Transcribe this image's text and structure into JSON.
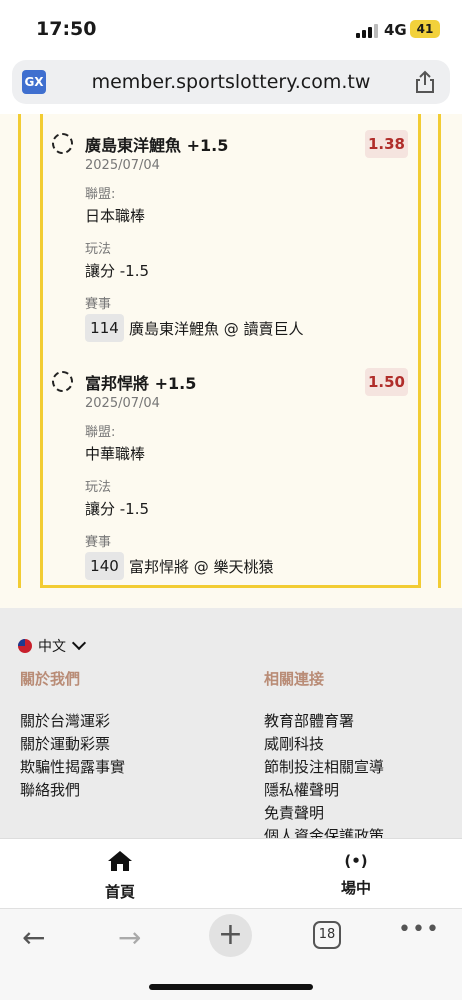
{
  "status": {
    "time": "17:50",
    "network": "4G",
    "battery": "41"
  },
  "browser": {
    "url": "member.sportslottery.com.tw",
    "translate_label": "GX",
    "tab_count": "18"
  },
  "bets": [
    {
      "team": "廣島東洋鯉魚 +1.5",
      "date": "2025/07/04",
      "odds": "1.38",
      "league_label": "聯盟:",
      "league": "日本職棒",
      "play_label": "玩法",
      "play": "讓分 -1.5",
      "event_label": "賽事",
      "event_num": "114",
      "event": "廣島東洋鯉魚 @ 讀賣巨人"
    },
    {
      "team": "富邦悍將 +1.5",
      "date": "2025/07/04",
      "odds": "1.50",
      "league_label": "聯盟:",
      "league": "中華職棒",
      "play_label": "玩法",
      "play": "讓分 -1.5",
      "event_label": "賽事",
      "event_num": "140",
      "event": "富邦悍將 @ 樂天桃猿"
    }
  ],
  "footer": {
    "language": "中文",
    "about_title": "關於我們",
    "about_links": [
      "關於台灣運彩",
      "關於運動彩票",
      "欺騙性揭露事實",
      "聯絡我們"
    ],
    "related_title": "相關連接",
    "related_links": [
      "教育部體育署",
      "威剛科技",
      "節制投注相關宣導",
      "隱私權聲明",
      "免責聲明",
      "個人資金保護政策"
    ]
  },
  "nav": {
    "home": "首頁",
    "live": "場中",
    "live_icon": "(•)"
  },
  "colors": {
    "rail": "#f2cc33",
    "odds_text": "#b02d2a",
    "odds_bg": "#f5e4df",
    "footer_head": "#b98c76"
  }
}
